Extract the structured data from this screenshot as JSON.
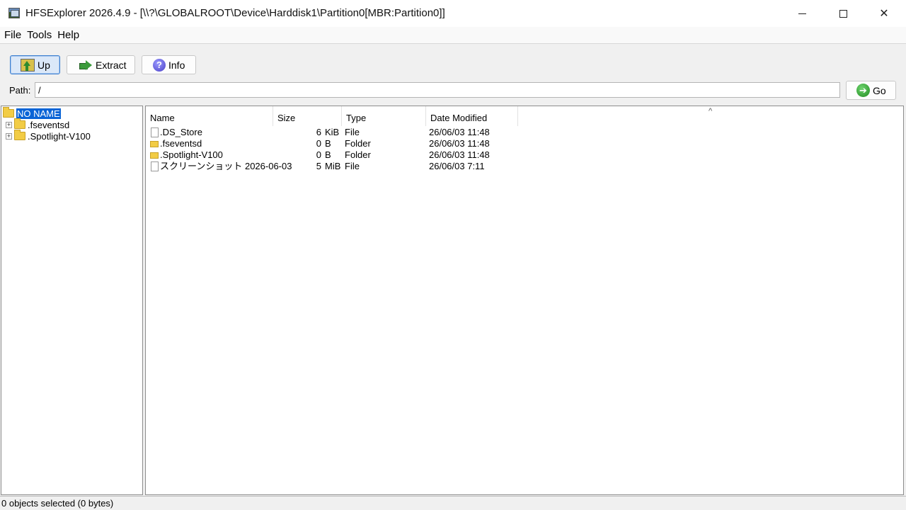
{
  "window": {
    "title": "HFSExplorer 2026.4.9 - [\\\\?\\GLOBALROOT\\Device\\Harddisk1\\Partition0[MBR:Partition0]]"
  },
  "menu": [
    "File",
    "Tools",
    "Help"
  ],
  "toolbar": {
    "up_label": "Up",
    "extract_label": "Extract",
    "info_label": "Info"
  },
  "path": {
    "label": "Path:",
    "value": "/",
    "go_label": "Go"
  },
  "tree": {
    "root": "NO NAME",
    "children": [
      ".fseventsd",
      ".Spotlight-V100"
    ]
  },
  "columns": {
    "name": "Name",
    "size": "Size",
    "type": "Type",
    "date": "Date Modified"
  },
  "sort_indicator": "^",
  "files": [
    {
      "name": ".DS_Store",
      "size": "6",
      "unit": "KiB",
      "type": "File",
      "date": "26/06/03 11:48",
      "icon": "file-icon"
    },
    {
      "name": ".fseventsd",
      "size": "0",
      "unit": "B",
      "type": "Folder",
      "date": "26/06/03 11:48",
      "icon": "folder-icon"
    },
    {
      "name": ".Spotlight-V100",
      "size": "0",
      "unit": "B",
      "type": "Folder",
      "date": "26/06/03 11:48",
      "icon": "folder-icon"
    },
    {
      "name": "スクリーンショット 2026-06-03",
      "size": "5",
      "unit": "MiB",
      "type": "File",
      "date": "26/06/03 7:11",
      "icon": "file-icon"
    }
  ],
  "status": "0 objects selected (0 bytes)"
}
